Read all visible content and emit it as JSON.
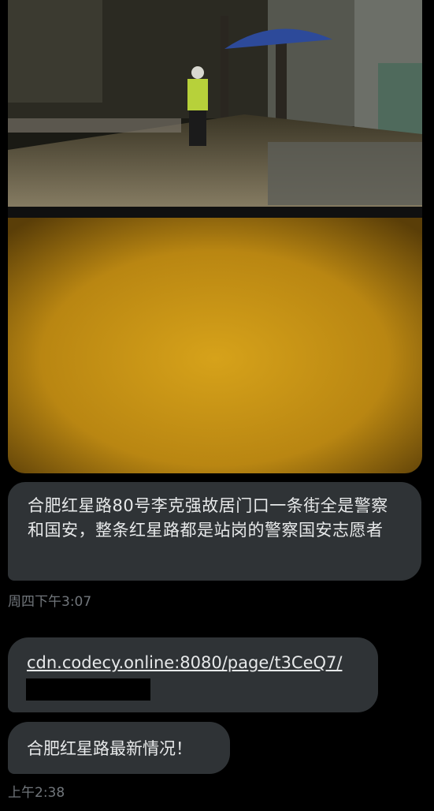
{
  "messages": [
    {
      "type": "image",
      "description_icon": "photo-image"
    },
    {
      "type": "text",
      "text": "合肥红星路80号李克强故居门口一条街全是警察和国安，整条红星路都是站岗的警察国安志愿者"
    }
  ],
  "timestamps": {
    "first": "周四下午3:07",
    "second": "上午2:38"
  },
  "link_message": {
    "url": "cdn.codecy.online:8080/page/t3CeQ7/"
  },
  "last_message": {
    "text": "合肥红星路最新情况！"
  },
  "colors": {
    "background": "#000000",
    "bubble": "#2f3336",
    "text": "#e7e9ea",
    "timestamp": "#71767b"
  }
}
